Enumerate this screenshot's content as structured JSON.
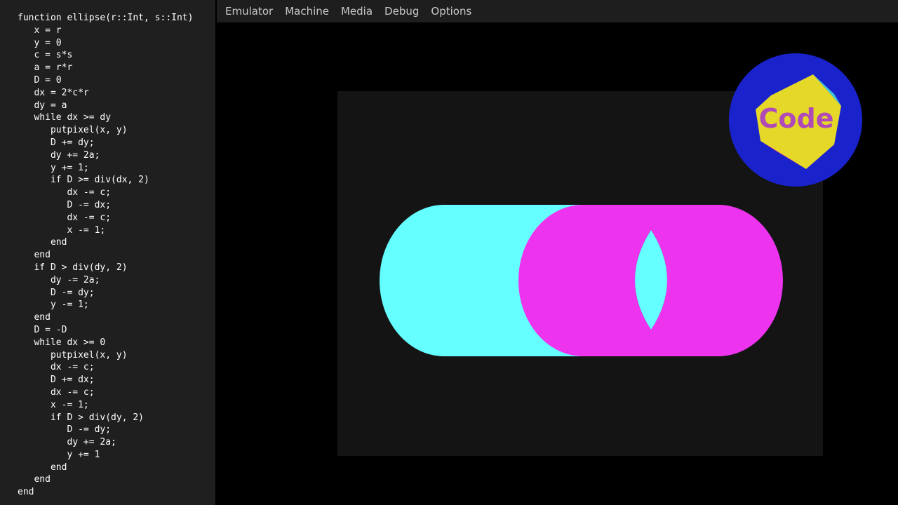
{
  "code": {
    "lines": [
      "function ellipse(r::Int, s::Int)",
      "   x = r",
      "   y = 0",
      "   c = s*s",
      "   a = r*r",
      "   D = 0",
      "   dx = 2*c*r",
      "   dy = a",
      "   while dx >= dy",
      "      putpixel(x, y)",
      "      D += dy;",
      "      dy += 2a;",
      "      y += 1;",
      "      if D >= div(dx, 2)",
      "         dx -= c;",
      "         D -= dx;",
      "         dx -= c;",
      "         x -= 1;",
      "      end",
      "   end",
      "   if D > div(dy, 2)",
      "      dy -= 2a;",
      "      D -= dy;",
      "      y -= 1;",
      "   end",
      "   D = -D",
      "   while dx >= 0",
      "      putpixel(x, y)",
      "      dx -= c;",
      "      D += dx;",
      "      dx -= c;",
      "      x -= 1;",
      "      if D > div(dy, 2)",
      "         D -= dy;",
      "         dy += 2a;",
      "         y += 1",
      "      end",
      "   end",
      "end"
    ]
  },
  "menu": {
    "items": [
      "Emulator",
      "Machine",
      "Media",
      "Debug",
      "Options"
    ]
  },
  "logo": {
    "text": "Code"
  },
  "colors": {
    "cyan_shape": "#66ffff",
    "magenta_shape": "#ee33ee",
    "screen_bg": "#141414",
    "logo_ring": "#1a22cc",
    "logo_gem": "#e6d828",
    "logo_text": "#b04ab8"
  }
}
